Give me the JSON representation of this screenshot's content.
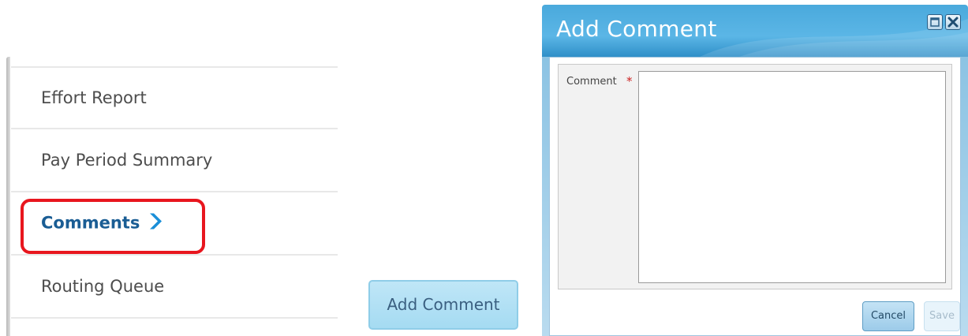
{
  "nav": {
    "items": [
      {
        "label": "Effort Report",
        "active": false
      },
      {
        "label": "Pay Period Summary",
        "active": false
      },
      {
        "label": "Comments",
        "active": true
      },
      {
        "label": "Routing Queue",
        "active": false
      }
    ],
    "active_chevron_icon": "chevron-right-icon",
    "highlight_color": "#e8161e",
    "active_color": "#1a5d94"
  },
  "add_button": {
    "label": "Add Comment"
  },
  "dialog": {
    "title": "Add Comment",
    "window_controls": [
      "maximize-icon",
      "close-icon"
    ],
    "comment_label": "Comment",
    "required_marker": "*",
    "comment_value": "",
    "cancel_label": "Cancel",
    "save_label": "Save",
    "header_color": "#4aa9dc"
  }
}
